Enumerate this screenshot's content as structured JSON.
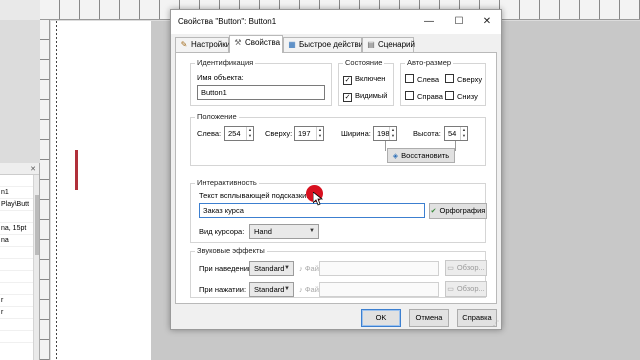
{
  "background": {
    "left_panel_rows": [
      "",
      "n1",
      "Play\\Butt",
      "",
      "na, 15pt",
      "na",
      "",
      "",
      "",
      "",
      "r",
      "r",
      "",
      ""
    ]
  },
  "dialog": {
    "title": "Свойства \"Button\": Button1",
    "window_buttons": {
      "minimize": "—",
      "maximize": "☐",
      "close": "✕"
    },
    "tabs": [
      {
        "label": "Настройки",
        "icon": "pencil-icon"
      },
      {
        "label": "Свойства",
        "icon": "wrench-icon",
        "active": true
      },
      {
        "label": "Быстрое действие",
        "icon": "grid-icon"
      },
      {
        "label": "Сценарий",
        "icon": "script-icon"
      }
    ],
    "identification": {
      "legend": "Идентификация",
      "name_label": "Имя объекта:",
      "name_value": "Button1"
    },
    "state": {
      "legend": "Состояние",
      "enabled_label": "Включен",
      "enabled_checked": true,
      "visible_label": "Видимый",
      "visible_checked": true
    },
    "autosize": {
      "legend": "Авто-размер",
      "left": "Слева",
      "top": "Сверху",
      "right": "Справа",
      "bottom": "Снизу"
    },
    "position": {
      "legend": "Положение",
      "left_label": "Слева:",
      "left_value": "254",
      "top_label": "Сверху:",
      "top_value": "197",
      "width_label": "Ширина:",
      "width_value": "198",
      "height_label": "Высота:",
      "height_value": "54",
      "restore_label": "Восстановить"
    },
    "interactivity": {
      "legend": "Интерактивность",
      "tooltip_label": "Текст всплывающей подсказки:",
      "tooltip_value": "Заказ курса",
      "spelling_label": "Орфография",
      "cursor_label": "Вид курсора:",
      "cursor_value": "Hand"
    },
    "sound": {
      "legend": "Звуковые эффекты",
      "hover_label": "При наведении:",
      "hover_value": "Standard",
      "click_label": "При нажатии:",
      "click_value": "Standard",
      "file_label": "Файл:",
      "browse_label": "Обзор..."
    },
    "footer": {
      "ok": "OK",
      "cancel": "Отмена",
      "help": "Справка"
    }
  },
  "colors": {
    "pointer": "#d8101f",
    "focus": "#3c7fd0"
  }
}
